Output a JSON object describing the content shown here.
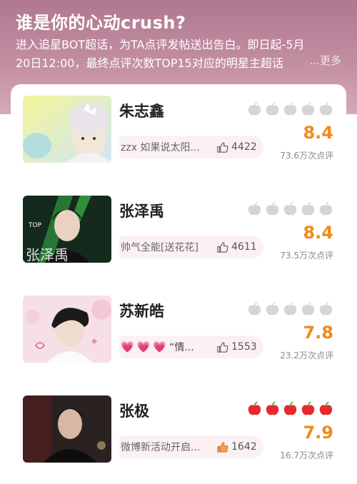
{
  "header": {
    "title": "谁是你的心动crush?",
    "desc_line1": "进入追星BOT超话，为TA点评发帖送出告白。即日起-5月",
    "desc_line2": "20日12:00，最终点评次数TOP15对应的明星主超话",
    "more_label": "...更多"
  },
  "colors": {
    "header_top": "#b07890",
    "score_orange": "#f08a1c",
    "apple_red": "#e8292b",
    "apple_grey": "#d5d5d5"
  },
  "items": [
    {
      "name": "朱志鑫",
      "quote": "zzx 如果说太阳...",
      "likes": "4422",
      "score": "8.4",
      "reviews": "73.6万次点评",
      "apples_filled": 0,
      "apples_total": 5
    },
    {
      "name": "张泽禹",
      "quote": "帅气全能[送花花]",
      "likes": "4611",
      "score": "8.4",
      "reviews": "73.5万次点评",
      "apples_filled": 0,
      "apples_total": 5
    },
    {
      "name": "苏新皓",
      "quote": "“情...",
      "likes": "1553",
      "score": "7.8",
      "reviews": "23.2万次点评",
      "apples_filled": 0,
      "apples_total": 5
    },
    {
      "name": "张极",
      "quote": "微博新活动开启...",
      "likes": "1642",
      "score": "7.9",
      "reviews": "16.7万次点评",
      "apples_filled": 5,
      "apples_total": 5
    }
  ],
  "thumb2_text": "张泽禹"
}
